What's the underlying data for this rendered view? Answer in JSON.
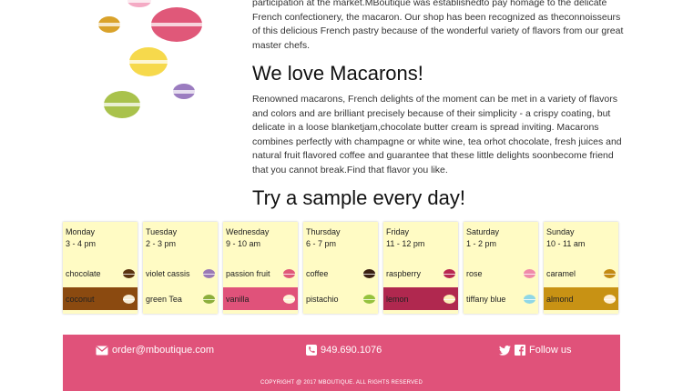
{
  "intro": {
    "text": "participation at the market.MBoutique was establishedto pay homage to the delicate French confectionery, the macaron. Our shop has been recognized as theconnoisseurs of this delicious French pastry because of the wonderful variety of flavors from our great master chefs."
  },
  "love": {
    "heading": "We love Macarons!",
    "paragraph": "Renowned macarons, French delights of the moment can be met in a variety of flavors and colors and are brilliant precisely because of their simplicity - a crispy coating, but delicate in a loose blanketjam,chocolate butter cream is spread inviting. Macarons combines perfectly with champagne or white wine, tea orhot chocolate, fresh juices and natural fruit flavored coffee and guarantee that these little delights soonbecome friend that you cannot break.Find that flavor you like."
  },
  "sample": {
    "heading": "Try a sample every day!"
  },
  "schedule": {
    "days": [
      {
        "day": "Monday",
        "time": "3 - 4 pm",
        "flavor1": "chocolate",
        "flavor1_color": "#5a3310",
        "flavor1_bg": "",
        "flavor2": "coconut",
        "flavor2_color": "#f6ecd6",
        "flavor2_bg": "#8b4a10"
      },
      {
        "day": "Tuesday",
        "time": "2 - 3 pm",
        "flavor1": "violet cassis",
        "flavor1_color": "#9a79b5",
        "flavor1_bg": "",
        "flavor2": "green Tea",
        "flavor2_color": "#8cae3c",
        "flavor2_bg": ""
      },
      {
        "day": "Wednesday",
        "time": "9 - 10 am",
        "flavor1": "passion fruit",
        "flavor1_color": "#e05879",
        "flavor1_bg": "",
        "flavor2": "vanilla",
        "flavor2_color": "#fff4d8",
        "flavor2_bg": "#e0527a"
      },
      {
        "day": "Thursday",
        "time": "6 - 7 pm",
        "flavor1": "coffee",
        "flavor1_color": "#3a1f12",
        "flavor1_bg": "",
        "flavor2": "pistachio",
        "flavor2_color": "#95c23e",
        "flavor2_bg": ""
      },
      {
        "day": "Friday",
        "time": "11 - 12 pm",
        "flavor1": "raspberry",
        "flavor1_color": "#b82750",
        "flavor1_bg": "",
        "flavor2": "lemon",
        "flavor2_color": "#fbefb8",
        "flavor2_bg": "#b0284f"
      },
      {
        "day": "Saturday",
        "time": "1 - 2 pm",
        "flavor1": "rose",
        "flavor1_color": "#f08aaa",
        "flavor1_bg": "",
        "flavor2": "tiffany blue",
        "flavor2_color": "#8fd7e6",
        "flavor2_bg": ""
      },
      {
        "day": "Sunday",
        "time": "10 - 11 am",
        "flavor1": "caramel",
        "flavor1_color": "#c38a12",
        "flavor1_bg": "",
        "flavor2": "almond",
        "flavor2_color": "#fff0d6",
        "flavor2_bg": "#c89214"
      }
    ]
  },
  "footer": {
    "email": "order@mboutique.com",
    "phone": "949.690.1076",
    "follow": "Follow us",
    "copyright": "COPYRIGHT @ 2017 MBOUTIQUE. ALL RIGHTS RESERVED",
    "bg_color": "#e0527a",
    "icons": [
      "envelope-icon",
      "phone-icon",
      "twitter-icon",
      "facebook-icon"
    ]
  },
  "decor": {
    "macaron_colors": [
      "#f4aac4",
      "#d9a22a",
      "#e05879",
      "#f6d94c",
      "#9b7cc0",
      "#a9c24c"
    ]
  }
}
